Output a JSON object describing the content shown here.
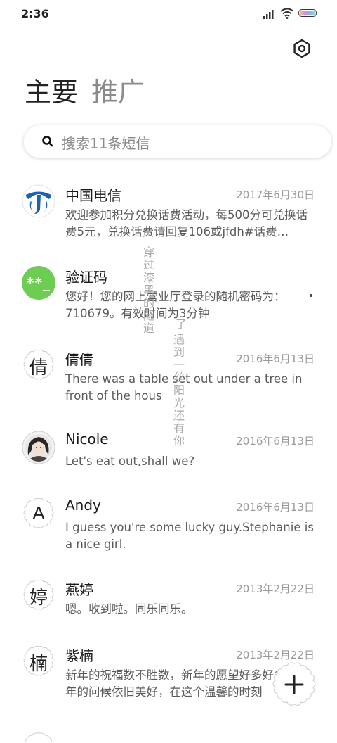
{
  "status": {
    "time": "2:36"
  },
  "tabs": [
    {
      "label": "主要",
      "active": true
    },
    {
      "label": "推广",
      "active": false
    }
  ],
  "search": {
    "placeholder": "搜索11条短信"
  },
  "conversations": [
    {
      "name": "中国电信",
      "date": "2017年6月30日",
      "preview": "欢迎参加积分兑换话费活动，每500分可兑换话费5元，兑换话费请回复106或jfdh#话费…",
      "avatar": "china-telecom-logo"
    },
    {
      "name": "验证码",
      "date": "",
      "preview": "您好！您的网上营业厅登录的随机密码为：710679。有效时间为3分钟",
      "avatar_text": "**_"
    },
    {
      "name": "倩倩",
      "date": "2016年6月13日",
      "preview": "There was a table set out under a tree in front of the hous",
      "avatar_text": "倩"
    },
    {
      "name": "Nicole",
      "date": "2016年6月13日",
      "preview": "Let's eat out,shall we?",
      "avatar": "photo"
    },
    {
      "name": "Andy",
      "date": "2016年6月13日",
      "preview": "I guess you're some lucky guy.Stephanie is a nice girl.",
      "avatar_text": "A"
    },
    {
      "name": "燕婷",
      "date": "2013年2月22日",
      "preview": "嗯。收到啦。同乐同乐。",
      "avatar_text": "婷"
    },
    {
      "name": "紫楠",
      "date": "2013年2月22日",
      "preview": "新年的祝福数不胜数，新年的愿望好多好多，新年的问候依旧美好，在这个温馨的时刻",
      "avatar_text": "楠"
    }
  ],
  "overlay": {
    "line1": "穿过漆黑的隧道",
    "line2": "遇到一丝阳光还有你",
    "line2_prefix": "了"
  },
  "colors": {
    "verify_green": "#6ccd52",
    "telecom_blue": "#1c64b0"
  },
  "icons": {
    "settings": "hexagon-gear-icon",
    "fab": "plus-icon"
  }
}
